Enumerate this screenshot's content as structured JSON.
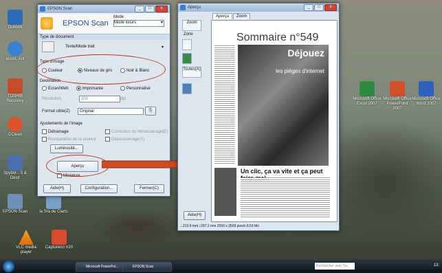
{
  "desktop": {
    "left_icons": [
      {
        "name": "Outlook",
        "label": "Outlook"
      },
      {
        "name": "assistant",
        "label": "assist. Ant"
      },
      {
        "name": "toshiba",
        "label": "TOSHIB Recovery"
      },
      {
        "name": "ccleaner",
        "label": "CClean"
      },
      {
        "name": "spybot",
        "label": "Spybot - S & Destr"
      },
      {
        "name": "epson-scan",
        "label": "EPSON Scan"
      },
      {
        "name": "clarte",
        "label": "la Sra de Clarts"
      },
      {
        "name": "vlc",
        "label": "VLC media player"
      },
      {
        "name": "capture",
        "label": "Capturerio V20"
      }
    ],
    "right_icons": [
      {
        "name": "excel",
        "label": "Microsoft Office Excel 2007"
      },
      {
        "name": "powerpoint",
        "label": "Microsoft Office PowerPoint 2007"
      },
      {
        "name": "word",
        "label": "Microsoft Office Word 2007"
      }
    ]
  },
  "epson": {
    "title": "EPSON Scan",
    "brand": "EPSON Scan",
    "mode_label": "Mode",
    "mode_value": "Mode loisirs",
    "doc_type_label": "Type de document",
    "doc_type_value": "Texte/Mode trait",
    "image_type_label": "Type d'image",
    "image_type_options": [
      "Couleur",
      "Niveaux de gris",
      "Noir & Blanc"
    ],
    "destination_label": "Destination",
    "destination_options": [
      "Ecran/Web",
      "Imprimante",
      "Personnalisé"
    ],
    "resolution_label": "Résolution",
    "resolution_value": "300",
    "resolution_unit": "dpi",
    "format_label": "Format cible(Z)",
    "format_value": "Original",
    "adjust_label": "Ajustements de l'image",
    "checks": [
      "Détramage",
      "Restauration de la couleur",
      "Correction du rétroéclairage(E)",
      "Dépoussiérage(Y)"
    ],
    "luminosity_button": "Luminosité...",
    "preview_button": "Aperçu",
    "miniature_label": "Miniature",
    "help_button": "Aide(H)",
    "config_button": "Configuration...",
    "close_button": "Fermer(C)"
  },
  "preview": {
    "title": "Aperçu",
    "tabs": [
      "Aperçu",
      "Zoom"
    ],
    "tools": [
      "Zoom",
      "Zone",
      "Toutes(A)"
    ],
    "help_button": "Aide(H)",
    "status": "↔213.9 mm  ↕297.2 mm  2550 x 3509 pixels 8.53 Mo",
    "magazine": {
      "title": "Sommaire n°549",
      "headline": "Déjouez",
      "sub": "les pièges d'internet",
      "bottom": "Un clic, ça va vite et ça peut faire mal"
    }
  },
  "taskbar": {
    "tasks": [
      "Microsoft PowerPoi...",
      "EPSON Scan"
    ],
    "search_placeholder": "Rechercher avec Go",
    "clock": "13:"
  }
}
